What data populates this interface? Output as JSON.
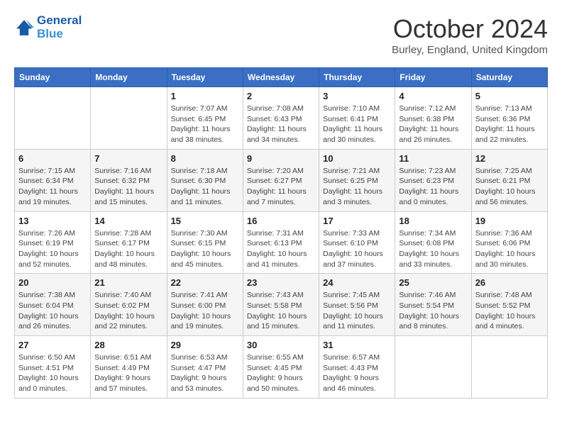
{
  "header": {
    "logo_line1": "General",
    "logo_line2": "Blue",
    "month": "October 2024",
    "location": "Burley, England, United Kingdom"
  },
  "days_of_week": [
    "Sunday",
    "Monday",
    "Tuesday",
    "Wednesday",
    "Thursday",
    "Friday",
    "Saturday"
  ],
  "weeks": [
    [
      {
        "day": "",
        "info": ""
      },
      {
        "day": "",
        "info": ""
      },
      {
        "day": "1",
        "info": "Sunrise: 7:07 AM\nSunset: 6:45 PM\nDaylight: 11 hours and 38 minutes."
      },
      {
        "day": "2",
        "info": "Sunrise: 7:08 AM\nSunset: 6:43 PM\nDaylight: 11 hours and 34 minutes."
      },
      {
        "day": "3",
        "info": "Sunrise: 7:10 AM\nSunset: 6:41 PM\nDaylight: 11 hours and 30 minutes."
      },
      {
        "day": "4",
        "info": "Sunrise: 7:12 AM\nSunset: 6:38 PM\nDaylight: 11 hours and 26 minutes."
      },
      {
        "day": "5",
        "info": "Sunrise: 7:13 AM\nSunset: 6:36 PM\nDaylight: 11 hours and 22 minutes."
      }
    ],
    [
      {
        "day": "6",
        "info": "Sunrise: 7:15 AM\nSunset: 6:34 PM\nDaylight: 11 hours and 19 minutes."
      },
      {
        "day": "7",
        "info": "Sunrise: 7:16 AM\nSunset: 6:32 PM\nDaylight: 11 hours and 15 minutes."
      },
      {
        "day": "8",
        "info": "Sunrise: 7:18 AM\nSunset: 6:30 PM\nDaylight: 11 hours and 11 minutes."
      },
      {
        "day": "9",
        "info": "Sunrise: 7:20 AM\nSunset: 6:27 PM\nDaylight: 11 hours and 7 minutes."
      },
      {
        "day": "10",
        "info": "Sunrise: 7:21 AM\nSunset: 6:25 PM\nDaylight: 11 hours and 3 minutes."
      },
      {
        "day": "11",
        "info": "Sunrise: 7:23 AM\nSunset: 6:23 PM\nDaylight: 11 hours and 0 minutes."
      },
      {
        "day": "12",
        "info": "Sunrise: 7:25 AM\nSunset: 6:21 PM\nDaylight: 10 hours and 56 minutes."
      }
    ],
    [
      {
        "day": "13",
        "info": "Sunrise: 7:26 AM\nSunset: 6:19 PM\nDaylight: 10 hours and 52 minutes."
      },
      {
        "day": "14",
        "info": "Sunrise: 7:28 AM\nSunset: 6:17 PM\nDaylight: 10 hours and 48 minutes."
      },
      {
        "day": "15",
        "info": "Sunrise: 7:30 AM\nSunset: 6:15 PM\nDaylight: 10 hours and 45 minutes."
      },
      {
        "day": "16",
        "info": "Sunrise: 7:31 AM\nSunset: 6:13 PM\nDaylight: 10 hours and 41 minutes."
      },
      {
        "day": "17",
        "info": "Sunrise: 7:33 AM\nSunset: 6:10 PM\nDaylight: 10 hours and 37 minutes."
      },
      {
        "day": "18",
        "info": "Sunrise: 7:34 AM\nSunset: 6:08 PM\nDaylight: 10 hours and 33 minutes."
      },
      {
        "day": "19",
        "info": "Sunrise: 7:36 AM\nSunset: 6:06 PM\nDaylight: 10 hours and 30 minutes."
      }
    ],
    [
      {
        "day": "20",
        "info": "Sunrise: 7:38 AM\nSunset: 6:04 PM\nDaylight: 10 hours and 26 minutes."
      },
      {
        "day": "21",
        "info": "Sunrise: 7:40 AM\nSunset: 6:02 PM\nDaylight: 10 hours and 22 minutes."
      },
      {
        "day": "22",
        "info": "Sunrise: 7:41 AM\nSunset: 6:00 PM\nDaylight: 10 hours and 19 minutes."
      },
      {
        "day": "23",
        "info": "Sunrise: 7:43 AM\nSunset: 5:58 PM\nDaylight: 10 hours and 15 minutes."
      },
      {
        "day": "24",
        "info": "Sunrise: 7:45 AM\nSunset: 5:56 PM\nDaylight: 10 hours and 11 minutes."
      },
      {
        "day": "25",
        "info": "Sunrise: 7:46 AM\nSunset: 5:54 PM\nDaylight: 10 hours and 8 minutes."
      },
      {
        "day": "26",
        "info": "Sunrise: 7:48 AM\nSunset: 5:52 PM\nDaylight: 10 hours and 4 minutes."
      }
    ],
    [
      {
        "day": "27",
        "info": "Sunrise: 6:50 AM\nSunset: 4:51 PM\nDaylight: 10 hours and 0 minutes."
      },
      {
        "day": "28",
        "info": "Sunrise: 6:51 AM\nSunset: 4:49 PM\nDaylight: 9 hours and 57 minutes."
      },
      {
        "day": "29",
        "info": "Sunrise: 6:53 AM\nSunset: 4:47 PM\nDaylight: 9 hours and 53 minutes."
      },
      {
        "day": "30",
        "info": "Sunrise: 6:55 AM\nSunset: 4:45 PM\nDaylight: 9 hours and 50 minutes."
      },
      {
        "day": "31",
        "info": "Sunrise: 6:57 AM\nSunset: 4:43 PM\nDaylight: 9 hours and 46 minutes."
      },
      {
        "day": "",
        "info": ""
      },
      {
        "day": "",
        "info": ""
      }
    ]
  ]
}
